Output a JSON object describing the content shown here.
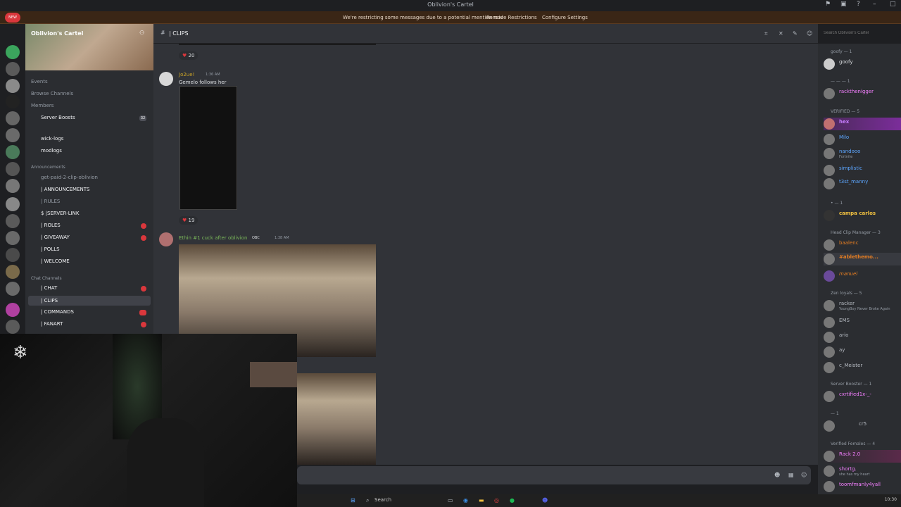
{
  "window": {
    "title": "Oblivion's Cartel"
  },
  "banner": {
    "message": "We're restricting some messages due to a potential mention raid",
    "remove_label": "Remove Restrictions",
    "configure_label": "Configure Settings"
  },
  "server": {
    "name": "Oblivion's Cartel",
    "new_badge": "NEW"
  },
  "sidebar": {
    "top_items": [
      "Events",
      "Browse Channels",
      "Members",
      "Server Boosts"
    ],
    "server_boosts_count": "32",
    "channels_a": [
      "wick-logs",
      "modlogs"
    ],
    "announcements_header": "Announcements",
    "announce_channels": [
      "get-paid-2-clip-oblivion",
      "| ANNOUNCEMENTS",
      "| RULES",
      "$ |SERVER-LINK",
      "| ROLES",
      "| GIVEAWAY",
      "| POLLS",
      "| WELCOME"
    ],
    "chat_header": "Chat Channels",
    "chat_channels": [
      "| CHAT",
      "| CLIPS",
      "| COMMANDS",
      "| FANART"
    ]
  },
  "channel": {
    "name": "| CLIPS",
    "search_placeholder": "Search Oblivion's Cartel"
  },
  "messages": [
    {
      "react_count": "20"
    },
    {
      "author": "Jo2ue!",
      "time": "1:36 AM",
      "text": "Gemelo follows her",
      "react_count": "19"
    },
    {
      "author": "Ethin #1 cuck after oblivion",
      "tag": "OBC",
      "time": "1:38 AM"
    }
  ],
  "members": {
    "groups": [
      {
        "header": "goofy — 1",
        "members": [
          {
            "name": "goofy",
            "color": "#dbdee1"
          }
        ]
      },
      {
        "header": "— — — 1",
        "members": [
          {
            "name": "rackthenigger",
            "color": "#f47fff",
            "tag": "4KT"
          }
        ]
      },
      {
        "header": "VERIFIED — 5",
        "members": [
          {
            "name": "hex",
            "color": "#c77dff"
          },
          {
            "name": "Milo",
            "color": "#5ca6ff"
          },
          {
            "name": "nandooo",
            "color": "#5ca6ff",
            "tag": "SDM",
            "status": "Fortnite"
          },
          {
            "name": "simplistic",
            "color": "#5ca6ff"
          },
          {
            "name": "t3st_manny",
            "color": "#5ca6ff",
            "tag": "z2z"
          }
        ]
      },
      {
        "header": "• — 1",
        "members": [
          {
            "name": "campa carlos",
            "color": "#f0c040"
          }
        ]
      },
      {
        "header": "Head Clip Manager — 3",
        "members": [
          {
            "name": "baalenc",
            "color": "#e67e22",
            "tag": "z2z"
          },
          {
            "name": "#ablethemo...",
            "color": "#e67e22",
            "tag": "WCKD"
          },
          {
            "name": "manuel",
            "color": "#e67e22",
            "tag": "z2z"
          }
        ]
      },
      {
        "header": "Zen loyals — 5",
        "members": [
          {
            "name": "racker",
            "color": "#b5bac1",
            "tag": "z2z",
            "status": "YoungBoy Never Broke Again"
          },
          {
            "name": "EMS",
            "color": "#b5bac1"
          },
          {
            "name": "ario",
            "color": "#b5bac1",
            "tag": "WRLS"
          },
          {
            "name": "ay",
            "color": "#b5bac1",
            "tag": "KING"
          },
          {
            "name": "c_Meister",
            "color": "#b5bac1"
          }
        ]
      },
      {
        "header": "Server Booster — 1",
        "members": [
          {
            "name": "cxrtified1x-_-",
            "color": "#f47fff",
            "tag": "OBC"
          }
        ]
      },
      {
        "header": "— 1",
        "members": [
          {
            "name": "",
            "color": "#b5bac1",
            "tag": "cr5"
          }
        ]
      },
      {
        "header": "Verified Females — 4",
        "members": [
          {
            "name": "Rack 2.0",
            "color": "#f47fff",
            "tag": "God"
          },
          {
            "name": "shortg.",
            "color": "#f47fff",
            "tag": "MC",
            "status": "she has my heart"
          },
          {
            "name": "toomfmanly4yall",
            "color": "#f47fff"
          }
        ]
      }
    ]
  },
  "taskbar": {
    "search_label": "Search",
    "time": "10:30"
  },
  "colors": {
    "accent": "#5865f2",
    "banner_bg": "#3a2616",
    "member_highlight": "#7b2d9a"
  }
}
